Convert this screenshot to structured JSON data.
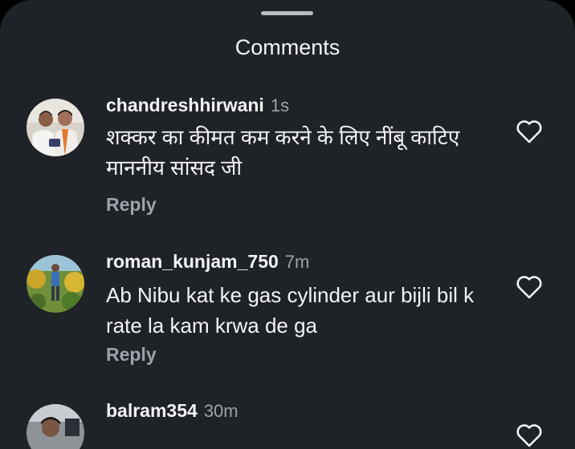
{
  "sheet": {
    "title": "Comments"
  },
  "comments": [
    {
      "username": "chandreshhirwani",
      "time": "1s",
      "text": "शक्कर का कीमत कम करने के लिए नींबू काटिए माननीय सांसद जी",
      "reply_label": "Reply",
      "avatar_icon": "profile-photo-two-men",
      "like_icon": "heart-outline-icon"
    },
    {
      "username": "roman_kunjam_750",
      "time": "7m",
      "text": "Ab Nibu kat ke gas cylinder aur bijli bil k  rate la kam krwa de ga",
      "reply_label": "Reply",
      "avatar_icon": "profile-photo-man-garden",
      "like_icon": "heart-outline-icon"
    },
    {
      "username": "balram354",
      "time": "30m",
      "avatar_icon": "profile-photo-man",
      "like_icon": "heart-outline-icon"
    }
  ],
  "colors": {
    "sheet_bg": "#1f2227",
    "text_primary": "#f2f3f5",
    "text_secondary": "#9fa3a9"
  }
}
